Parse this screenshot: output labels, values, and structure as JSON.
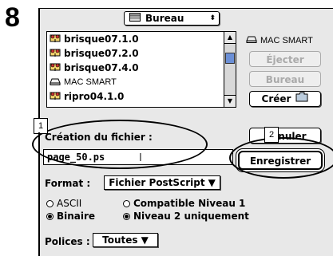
{
  "step_number": "8",
  "dialog": {
    "folder_popup": {
      "label": "Bureau",
      "arrows": "▲\n▼"
    },
    "file_list": [
      {
        "icon": "network-folder-icon",
        "name": "brisque07.1.0"
      },
      {
        "icon": "network-folder-icon",
        "name": "brisque07.2.0"
      },
      {
        "icon": "network-folder-icon",
        "name": "brisque07.4.0"
      },
      {
        "icon": "disk-icon",
        "name": "MAC SMART"
      },
      {
        "icon": "network-folder-icon",
        "name": "ripro04.1.0"
      }
    ],
    "disk_name": "MAC SMART",
    "buttons": {
      "eject": "Éjecter",
      "desktop": "Bureau",
      "create": "Créer",
      "cancel": "Annuler",
      "save": "Enregistrer"
    },
    "filename_label": "Création du fichier :",
    "filename_value": "page_50.ps",
    "format_label": "Format :",
    "format_value": "Fichier PostScript",
    "radio_options": {
      "ascii": "ASCII",
      "binary": "Binaire",
      "compat": "Compatible Niveau 1",
      "level2": "Niveau 2 uniquement"
    },
    "fonts_label": "Polices :",
    "fonts_value": "Toutes"
  },
  "annotations": {
    "callout_1": "1",
    "callout_2": "2"
  }
}
